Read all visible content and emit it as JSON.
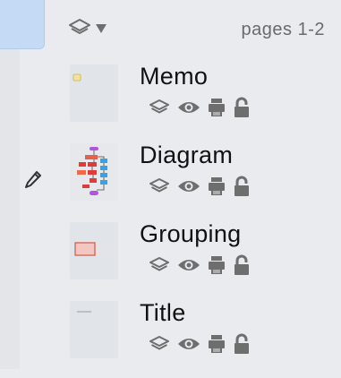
{
  "header": {
    "pages_label": "pages 1-2",
    "layers_menu_icon": "layers-stack-icon",
    "dropdown_icon": "triangle-down-icon"
  },
  "layers": [
    {
      "name": "Memo",
      "thumbnail": "memo",
      "current": false
    },
    {
      "name": "Diagram",
      "thumbnail": "diagram",
      "current": true
    },
    {
      "name": "Grouping",
      "thumbnail": "grouping",
      "current": false
    },
    {
      "name": "Title",
      "thumbnail": "title",
      "current": false
    }
  ],
  "row_icons": [
    "layers-stack-icon",
    "eye-icon",
    "printer-icon",
    "padlock-icon"
  ],
  "colors": {
    "background": "#e9ebee",
    "selected_tab": "#c5daf5",
    "icon_gray": "#6e6e6e",
    "text": "#111111"
  }
}
